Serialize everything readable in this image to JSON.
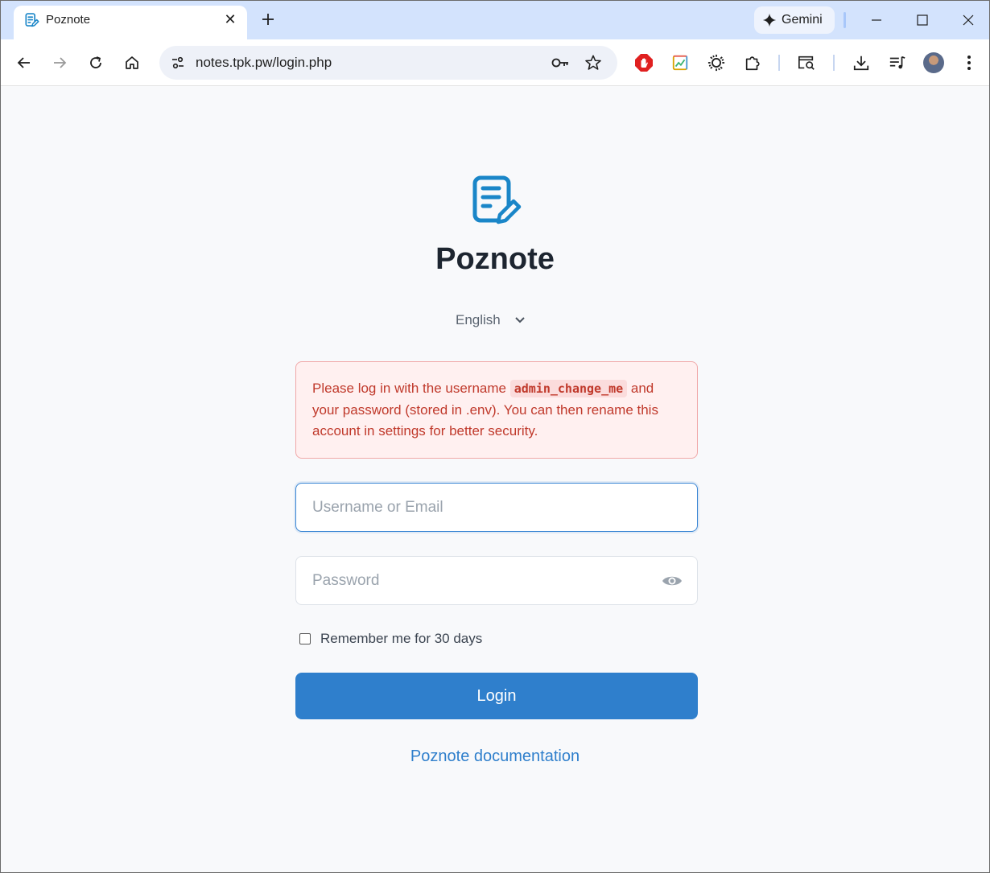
{
  "browser": {
    "tab": {
      "title": "Poznote",
      "close_glyph": "✕",
      "icon": "notepad-icon"
    },
    "new_tab_glyph": "+",
    "gemini_label": "Gemini",
    "url": "notes.tpk.pw/login.php",
    "accent": "#d3e3fd"
  },
  "page": {
    "app_title": "Poznote",
    "language": {
      "selected": "English",
      "options": [
        "English"
      ]
    },
    "alert": {
      "prefix": "Please log in with the username ",
      "username": "admin_change_me",
      "suffix": " and your password (stored in .env). You can then rename this account in settings for better security."
    },
    "username_placeholder": "Username or Email",
    "username_value": "",
    "password_placeholder": "Password",
    "password_value": "",
    "remember_label": "Remember me for 30 days",
    "remember_checked": false,
    "login_label": "Login",
    "doc_link_label": "Poznote documentation",
    "colors": {
      "primary": "#2f7fcc",
      "alert_text": "#c0392b",
      "alert_bg": "#fff0f0",
      "alert_border": "#f0a8a8",
      "logo": "#1a86c8"
    }
  }
}
